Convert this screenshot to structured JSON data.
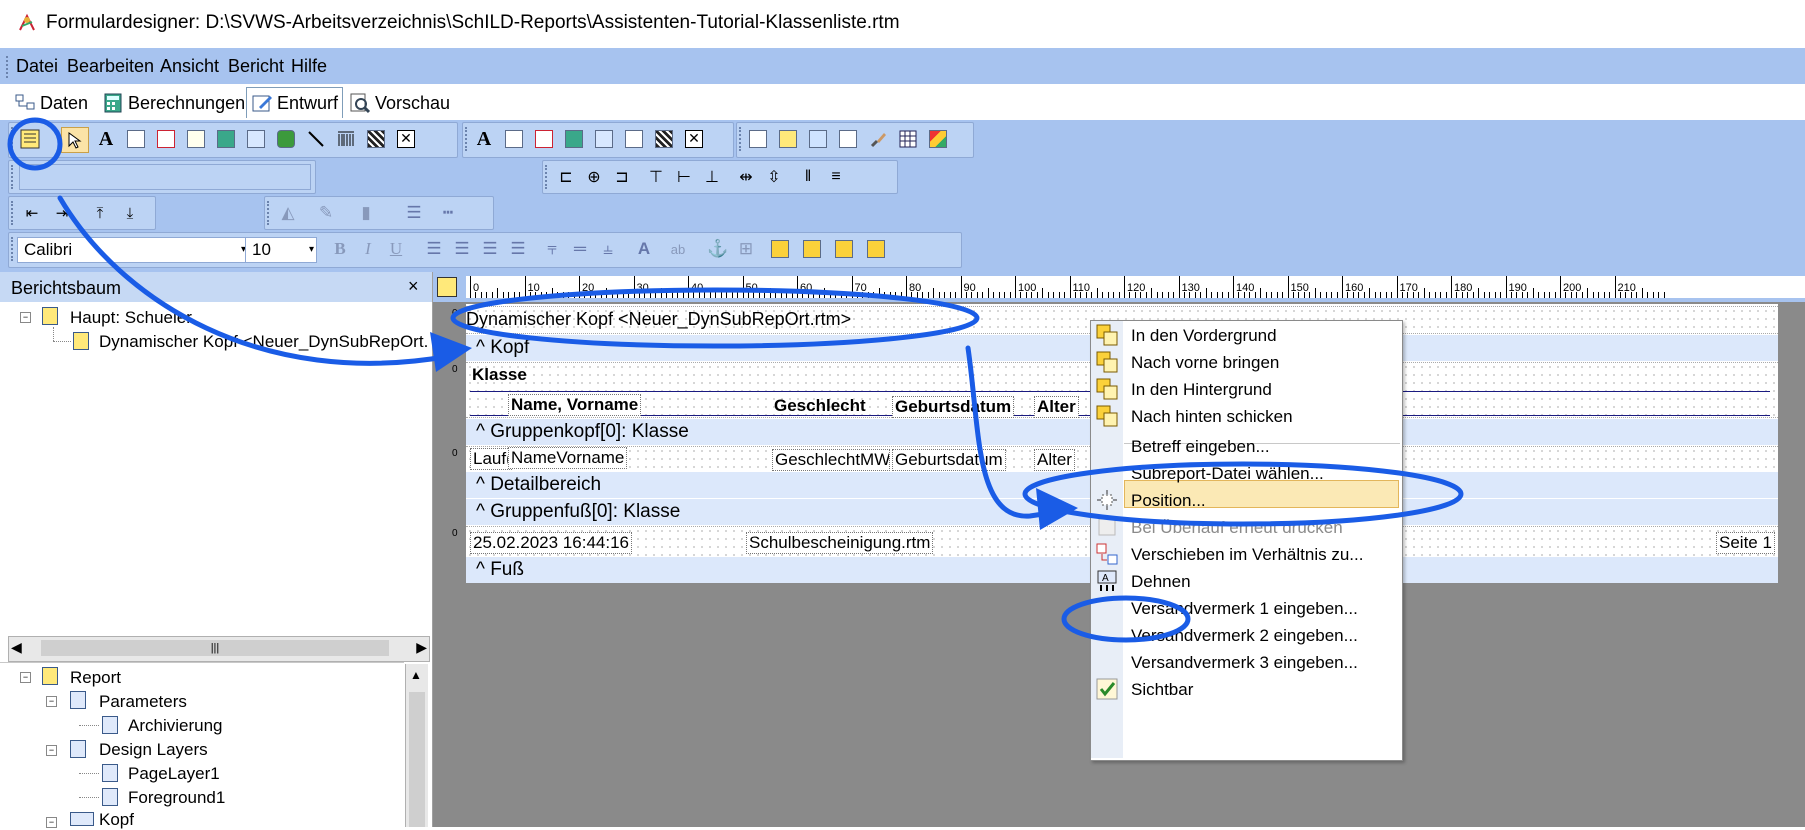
{
  "window": {
    "title": "Formulardesigner: D:\\SVWS-Arbeitsverzeichnis\\SchILD-Reports\\Assistenten-Tutorial-Klassenliste.rtm"
  },
  "menu": [
    "Datei",
    "Bearbeiten",
    "Ansicht",
    "Bericht",
    "Hilfe"
  ],
  "tabs": [
    {
      "label": "Daten",
      "icon": "data-tree-icon"
    },
    {
      "label": "Berechnungen",
      "icon": "calculator-icon"
    },
    {
      "label": "Entwurf",
      "icon": "design-pencil-icon",
      "active": true
    },
    {
      "label": "Vorschau",
      "icon": "preview-magnifier-icon"
    }
  ],
  "format_toolbar": {
    "font": "Calibri",
    "size": "10"
  },
  "report_tree": {
    "title": "Berichtsbaum",
    "close": "×",
    "items": [
      "Haupt: Schueler",
      "Dynamischer Kopf <Neuer_DynSubRepOrt.rtm>"
    ]
  },
  "object_tree": {
    "items": [
      "Report",
      "Parameters",
      "Archivierung",
      "Design Layers",
      "PageLayer1",
      "Foreground1",
      "Kopf"
    ]
  },
  "ruler": {
    "labels": [
      "0",
      "10",
      "20",
      "30",
      "40",
      "50",
      "60",
      "70",
      "80",
      "90",
      "100",
      "110",
      "120",
      "130",
      "140",
      "150",
      "160",
      "170",
      "180",
      "190",
      "200",
      "210"
    ]
  },
  "bands": {
    "dynamic_header": "Dynamischer Kopf <Neuer_DynSubRepOrt.rtm>",
    "header": "^  Kopf",
    "group_header": "^  Gruppenkopf[0]: Klasse",
    "detail": "^  Detailbereich",
    "group_footer": "^  Gruppenfuß[0]: Klasse",
    "footer": "^  Fuß"
  },
  "fields": {
    "klasse": "Klasse",
    "col_name": "Name, Vorname",
    "col_gender": "Geschlecht",
    "col_birth": "Geburtsdatum",
    "col_age": "Alter",
    "lauf": "Lauf(",
    "namevorname": "NameVorname",
    "geschlecht": "GeschlechtMW",
    "geburtsdatum": "Geburtsdatum",
    "alter": "Alter",
    "datetime": "25.02.2023 16:44:16",
    "file": "Schulbescheinigung.rtm",
    "page": "Seite 1",
    "row_zero": "0"
  },
  "context_menu": {
    "items": [
      {
        "label": "In  den  Vordergrund",
        "icon": "bring-to-front-icon"
      },
      {
        "label": "Nach vorne bringen",
        "icon": "bring-forward-icon"
      },
      {
        "label": "In den Hintergrund",
        "icon": "send-to-back-icon"
      },
      {
        "label": "Nach hinten schicken",
        "icon": "send-backward-icon"
      },
      {
        "label": "Betreff eingeben...",
        "icon": ""
      },
      {
        "label": "Subreport-Datei wählen...",
        "icon": "",
        "highlighted": true
      },
      {
        "label": "Position...",
        "icon": "position-icon"
      },
      {
        "label": "Bei Überlauf erneut drucken",
        "icon": "reprint-icon",
        "disabled": true
      },
      {
        "label": "Verschieben im Verhältnis zu...",
        "icon": "shift-relative-icon"
      },
      {
        "label": "Dehnen",
        "icon": "stretch-icon"
      },
      {
        "label": "Versandvermerk 1 eingeben...",
        "icon": ""
      },
      {
        "label": "Versandvermerk 2 eingeben...",
        "icon": ""
      },
      {
        "label": "Versandvermerk 3 eingeben...",
        "icon": ""
      },
      {
        "label": "Sichtbar",
        "icon": "checkmark-icon",
        "checked": true
      }
    ]
  },
  "colors": {
    "annotation": "#1a5ce6",
    "toolbar": "#a7c3ef",
    "band": "#dce8fb",
    "highlight": "#fbe9b5"
  }
}
